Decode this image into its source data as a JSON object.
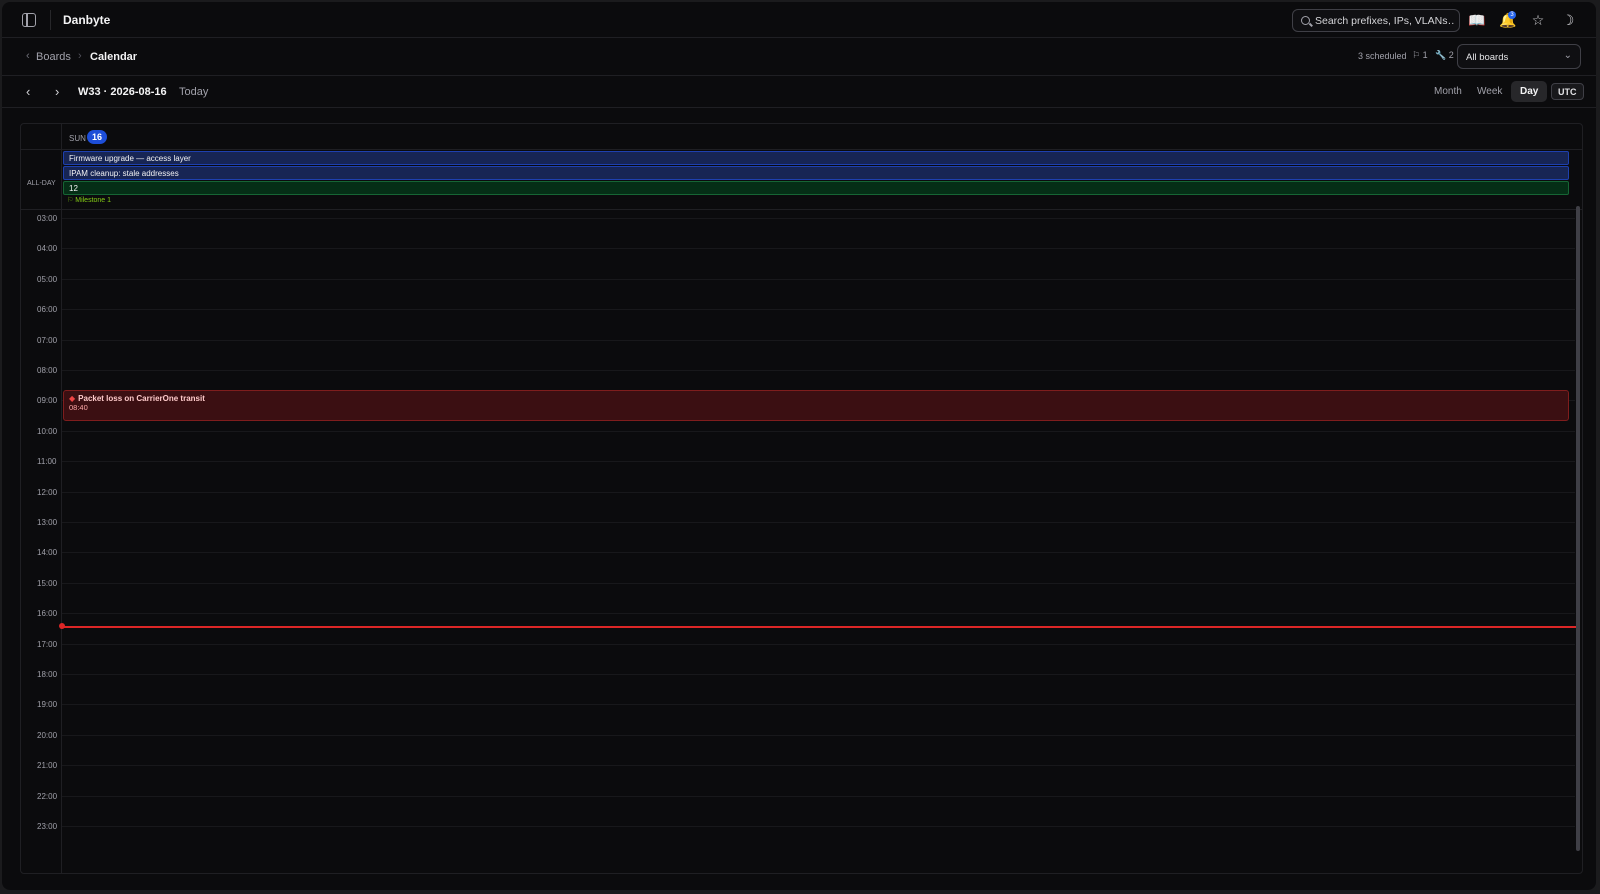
{
  "app": {
    "title": "Danbyte"
  },
  "topbar": {
    "search_placeholder": "Search prefixes, IPs, VLANs…",
    "notification_count": "3",
    "icons": [
      "sidebar-toggle-icon",
      "book-icon",
      "bell-icon",
      "star-icon",
      "moon-icon"
    ]
  },
  "breadcrumb": {
    "back": "‹",
    "parent": "Boards",
    "separator": "›",
    "current": "Calendar"
  },
  "summary": {
    "scheduled": "3 scheduled",
    "flags": "1",
    "wrenches": "2",
    "board_filter": "All boards"
  },
  "nav": {
    "prev": "‹",
    "next": "›",
    "period": "W33 · 2026-08-16",
    "today": "Today",
    "views": [
      "Month",
      "Week",
      "Day"
    ],
    "active_view": "Day",
    "timezone": "UTC"
  },
  "day": {
    "dow": "SUN",
    "number": "16"
  },
  "all_day": {
    "label": "ALL-DAY",
    "events": [
      {
        "title": "Firmware upgrade — access layer",
        "color": "#1e40af"
      },
      {
        "title": "IPAM cleanup: stale addresses",
        "color": "#1e40af"
      },
      {
        "title": "12",
        "color": "#166534"
      }
    ],
    "milestone": "Milestone 1"
  },
  "hours": [
    "03:00",
    "04:00",
    "05:00",
    "06:00",
    "07:00",
    "08:00",
    "09:00",
    "10:00",
    "11:00",
    "12:00",
    "13:00",
    "14:00",
    "15:00",
    "16:00",
    "17:00",
    "18:00",
    "19:00",
    "20:00",
    "21:00",
    "22:00",
    "23:00"
  ],
  "events": [
    {
      "title": "Packet loss on CarrierOne transit",
      "time": "08:40",
      "color": "#7f1d1d"
    }
  ],
  "now_indicator_color": "#dc2626"
}
